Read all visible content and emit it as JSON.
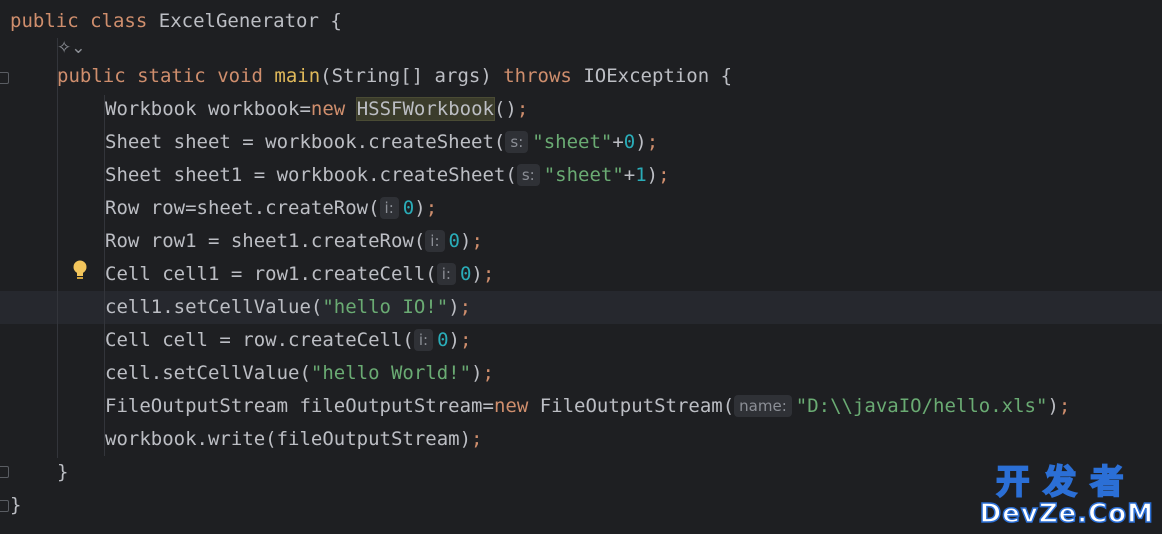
{
  "editor": {
    "hints": {
      "s": "s:",
      "i": "i:",
      "name": "name:"
    },
    "ai_icon_glyph": "✧⌄",
    "watermark": {
      "cn": "开发者",
      "en": "DevZe.CoM"
    }
  },
  "code": {
    "l1_public": "public",
    "l1_class": "class",
    "l1_name": "ExcelGenerator",
    "l1_brace": "{",
    "l2_public": "public",
    "l2_static": "static",
    "l2_void": "void",
    "l2_main": "main",
    "l2_params_a": "(String[] args)",
    "l2_throws": "throws",
    "l2_exc": "IOException {",
    "l3_a": "Workbook workbook=",
    "l3_new": "new",
    "l3_cls": "HSSFWorkbook",
    "l3_b": "()",
    "l4_a": "Sheet sheet = workbook.createSheet(",
    "l4_str": "\"sheet\"",
    "l4_plus": "+",
    "l4_num": "0",
    "l4_b": ")",
    "l5_a": "Sheet sheet1 = workbook.createSheet(",
    "l5_str": "\"sheet\"",
    "l5_plus": "+",
    "l5_num": "1",
    "l5_b": ")",
    "l6_a": "Row row=sheet.createRow(",
    "l6_num": "0",
    "l6_b": ")",
    "l7_a": "Row row1 = sheet1.createRow(",
    "l7_num": "0",
    "l7_b": ")",
    "l8_a": "Cell cell1 = row1.createCell(",
    "l8_num": "0",
    "l8_b": ")",
    "l9_a": "cell1.setCellValue(",
    "l9_str": "\"hello IO!\"",
    "l9_b": ")",
    "l10_a": "Cell cell = row.createCell(",
    "l10_num": "0",
    "l10_b": ")",
    "l11_a": "cell.setCellValue(",
    "l11_str": "\"hello World!\"",
    "l11_b": ")",
    "l12_a": "FileOutputStream fileOutputStream=",
    "l12_new": "new",
    "l12_cls": " FileOutputStream(",
    "l12_str": "\"D:\\\\javaIO/hello.xls\"",
    "l12_b": ")",
    "l13_a": "workbook.write(fileOutputStream)",
    "semicolon": ";",
    "close_method": "}",
    "close_class": "}"
  }
}
